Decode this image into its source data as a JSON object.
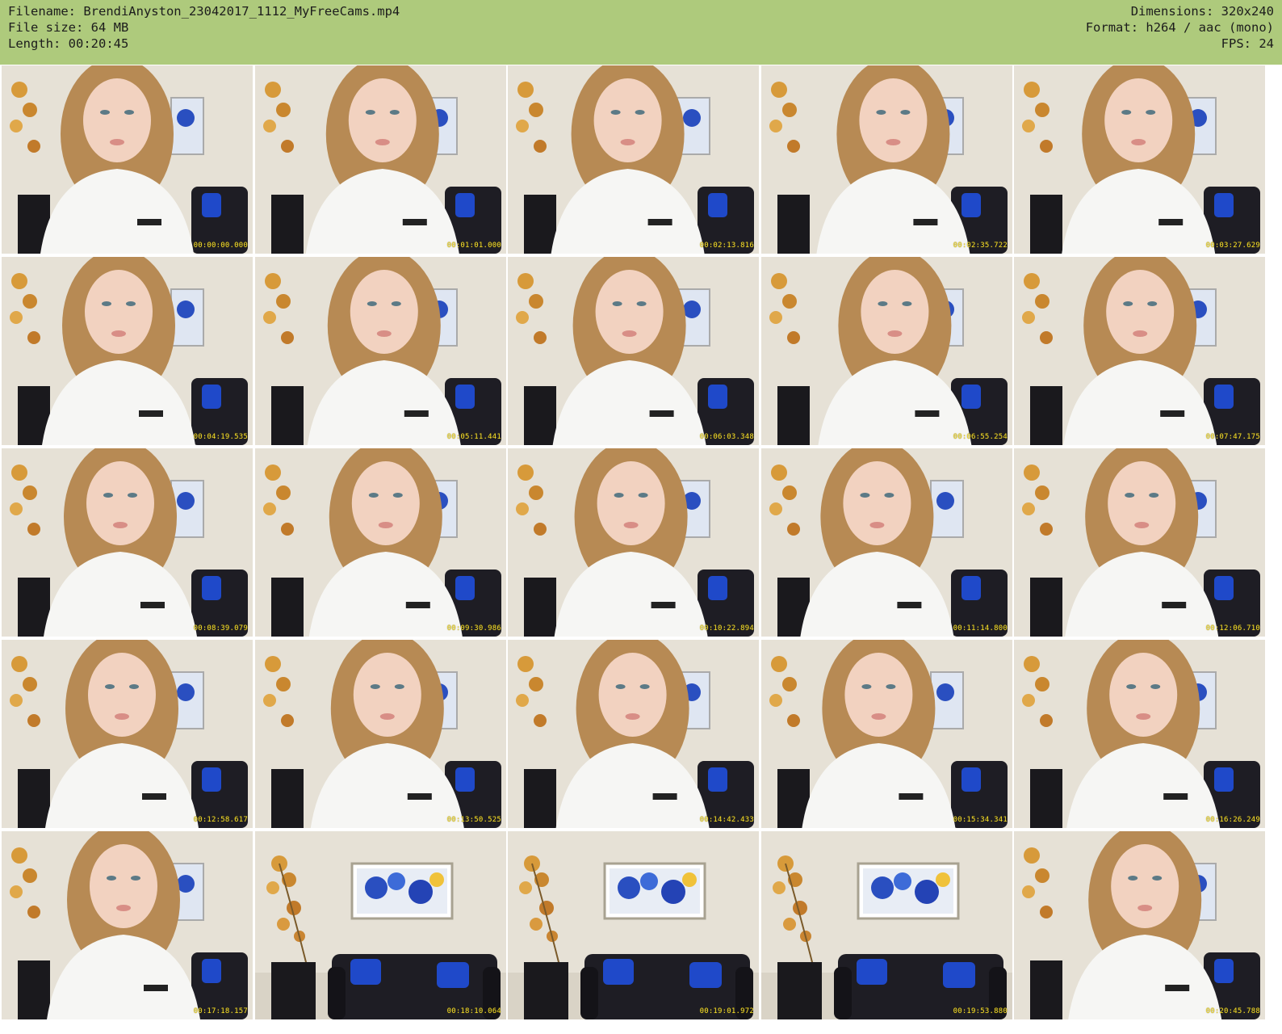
{
  "header": {
    "filename": "Filename: BrendiAnyston_23042017_1112_MyFreeCams.mp4",
    "filesize": "File size: 64 MB",
    "length": "Length: 00:20:45",
    "dimensions": "Dimensions: 320x240",
    "format": "Format: h264 / aac (mono)",
    "fps": "FPS: 24"
  },
  "colors": {
    "header_bg": "#aeca7c",
    "timestamp": "#f2dc2e",
    "wall": "#e6e1d6",
    "sofa": "#1e1d24",
    "pillow": "#1f49c9",
    "sweater": "#f6f6f4",
    "hair": "#b78a54"
  },
  "thumbnails": [
    {
      "timestamp": "00:00:00.000",
      "scene": "person"
    },
    {
      "timestamp": "00:01:01.000",
      "scene": "person"
    },
    {
      "timestamp": "00:02:13.816",
      "scene": "person"
    },
    {
      "timestamp": "00:02:35.722",
      "scene": "person"
    },
    {
      "timestamp": "00:03:27.629",
      "scene": "person"
    },
    {
      "timestamp": "00:04:19.535",
      "scene": "person"
    },
    {
      "timestamp": "00:05:11.441",
      "scene": "person"
    },
    {
      "timestamp": "00:06:03.348",
      "scene": "person"
    },
    {
      "timestamp": "00:06:55.254",
      "scene": "person"
    },
    {
      "timestamp": "00:07:47.175",
      "scene": "person"
    },
    {
      "timestamp": "00:08:39.079",
      "scene": "person"
    },
    {
      "timestamp": "00:09:30.986",
      "scene": "person"
    },
    {
      "timestamp": "00:10:22.894",
      "scene": "person"
    },
    {
      "timestamp": "00:11:14.800",
      "scene": "person"
    },
    {
      "timestamp": "00:12:06.710",
      "scene": "person"
    },
    {
      "timestamp": "00:12:58.617",
      "scene": "person"
    },
    {
      "timestamp": "00:13:50.525",
      "scene": "person"
    },
    {
      "timestamp": "00:14:42.433",
      "scene": "person"
    },
    {
      "timestamp": "00:15:34.341",
      "scene": "person"
    },
    {
      "timestamp": "00:16:26.249",
      "scene": "person"
    },
    {
      "timestamp": "00:17:18.157",
      "scene": "person"
    },
    {
      "timestamp": "00:18:10.064",
      "scene": "room"
    },
    {
      "timestamp": "00:19:01.972",
      "scene": "room"
    },
    {
      "timestamp": "00:19:53.880",
      "scene": "room"
    },
    {
      "timestamp": "00:20:45.788",
      "scene": "person"
    }
  ]
}
